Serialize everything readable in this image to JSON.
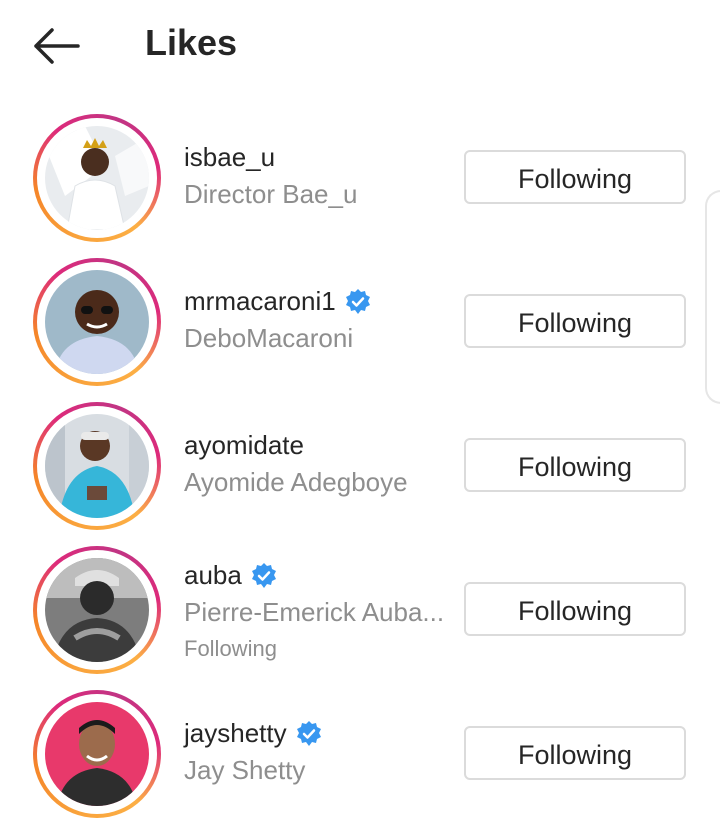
{
  "header": {
    "title": "Likes",
    "back_icon": "arrow-left-icon"
  },
  "colors": {
    "ring_start": "#f58529",
    "ring_end": "#c13584",
    "verified": "#3897f0",
    "secondary_text": "#8e8e8e"
  },
  "users": [
    {
      "username": "isbae_u",
      "full_name": "Director Bae_u",
      "verified": false,
      "subtext": "",
      "button": "Following"
    },
    {
      "username": "mrmacaroni1",
      "full_name": "DeboMacaroni",
      "verified": true,
      "subtext": "",
      "button": "Following"
    },
    {
      "username": "ayomidate",
      "full_name": "Ayomide Adegboye",
      "verified": false,
      "subtext": "",
      "button": "Following"
    },
    {
      "username": "auba",
      "full_name": "Pierre-Emerick Auba...",
      "verified": true,
      "subtext": "Following",
      "button": "Following"
    },
    {
      "username": "jayshetty",
      "full_name": "Jay Shetty",
      "verified": true,
      "subtext": "",
      "button": "Following"
    }
  ]
}
